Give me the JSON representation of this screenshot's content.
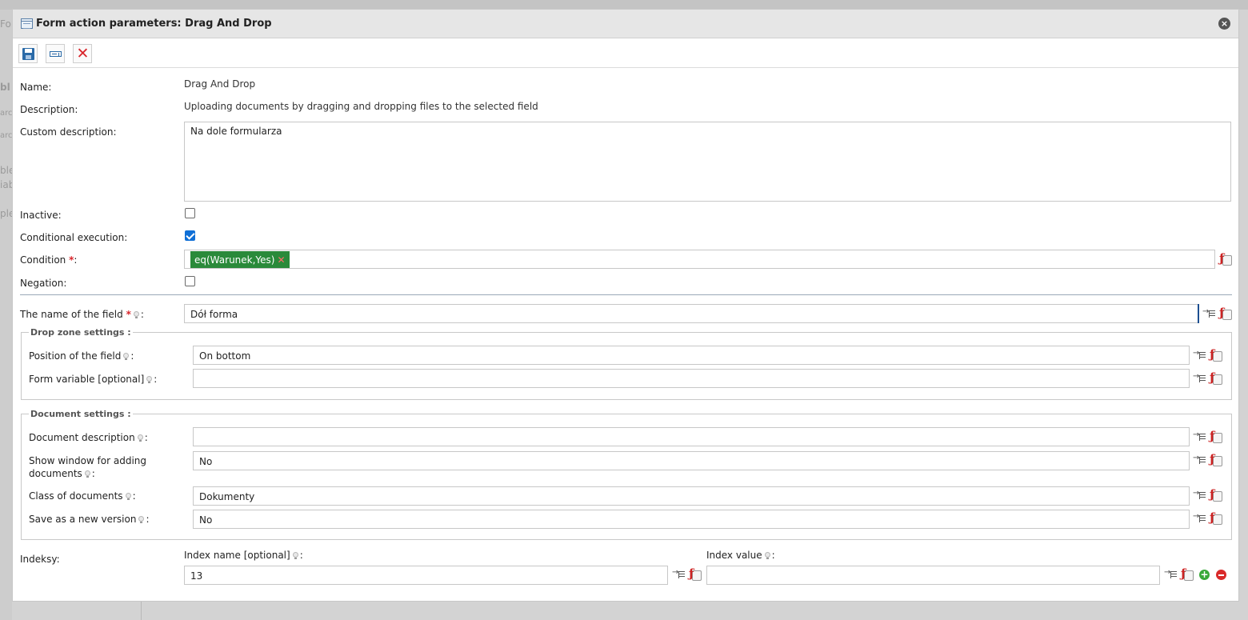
{
  "background": {
    "fragments": [
      "For",
      "bl",
      "arc",
      "arc",
      "ble",
      "iab",
      "ple"
    ]
  },
  "dialog": {
    "title": "Form action parameters: Drag And Drop",
    "close_symbol": "×"
  },
  "toolbar": {
    "save_icon": "save-icon",
    "field_icon": "field-icon",
    "cancel_symbol": "✕"
  },
  "form": {
    "name_label": "Name:",
    "name_value": "Drag And Drop",
    "description_label": "Description:",
    "description_value": "Uploading documents by dragging and dropping files to the selected field",
    "custom_description_label": "Custom description:",
    "custom_description_value": "Na dole formularza",
    "inactive_label": "Inactive:",
    "inactive_checked": false,
    "conditional_label": "Conditional execution:",
    "conditional_checked": true,
    "condition_label": "Condition",
    "condition_required": "*",
    "condition_colon": ":",
    "condition_chip": "eq(Warunek,Yes)",
    "condition_chip_remove": "✕",
    "negation_label": "Negation:",
    "negation_checked": false,
    "field_name_label": "The name of the field",
    "field_name_required": "*",
    "field_name_colon": ":",
    "field_name_value": "Dół forma"
  },
  "drop_zone": {
    "legend": "Drop zone settings :",
    "position_label": "Position of the field",
    "position_value": "On bottom",
    "form_variable_label": "Form variable [optional]",
    "form_variable_value": "",
    "colon": ":"
  },
  "document_settings": {
    "legend": "Document settings :",
    "doc_description_label": "Document description",
    "doc_description_value": "",
    "show_window_label_1": "Show window for adding",
    "show_window_label_2": "documents",
    "show_window_value": "No",
    "class_label": "Class of documents",
    "class_value": "Dokumenty",
    "save_version_label": "Save as a new version",
    "save_version_value": "No",
    "colon": ":"
  },
  "indexes": {
    "label": "Indeksy:",
    "index_name_label": "Index name [optional]",
    "index_name_value": "13",
    "index_value_label": "Index value",
    "index_value_value": "",
    "colon": ":"
  },
  "colors": {
    "chip_green": "#2a8a3a",
    "checkbox_blue": "#0f6fd6",
    "required_red": "#d9262c"
  }
}
